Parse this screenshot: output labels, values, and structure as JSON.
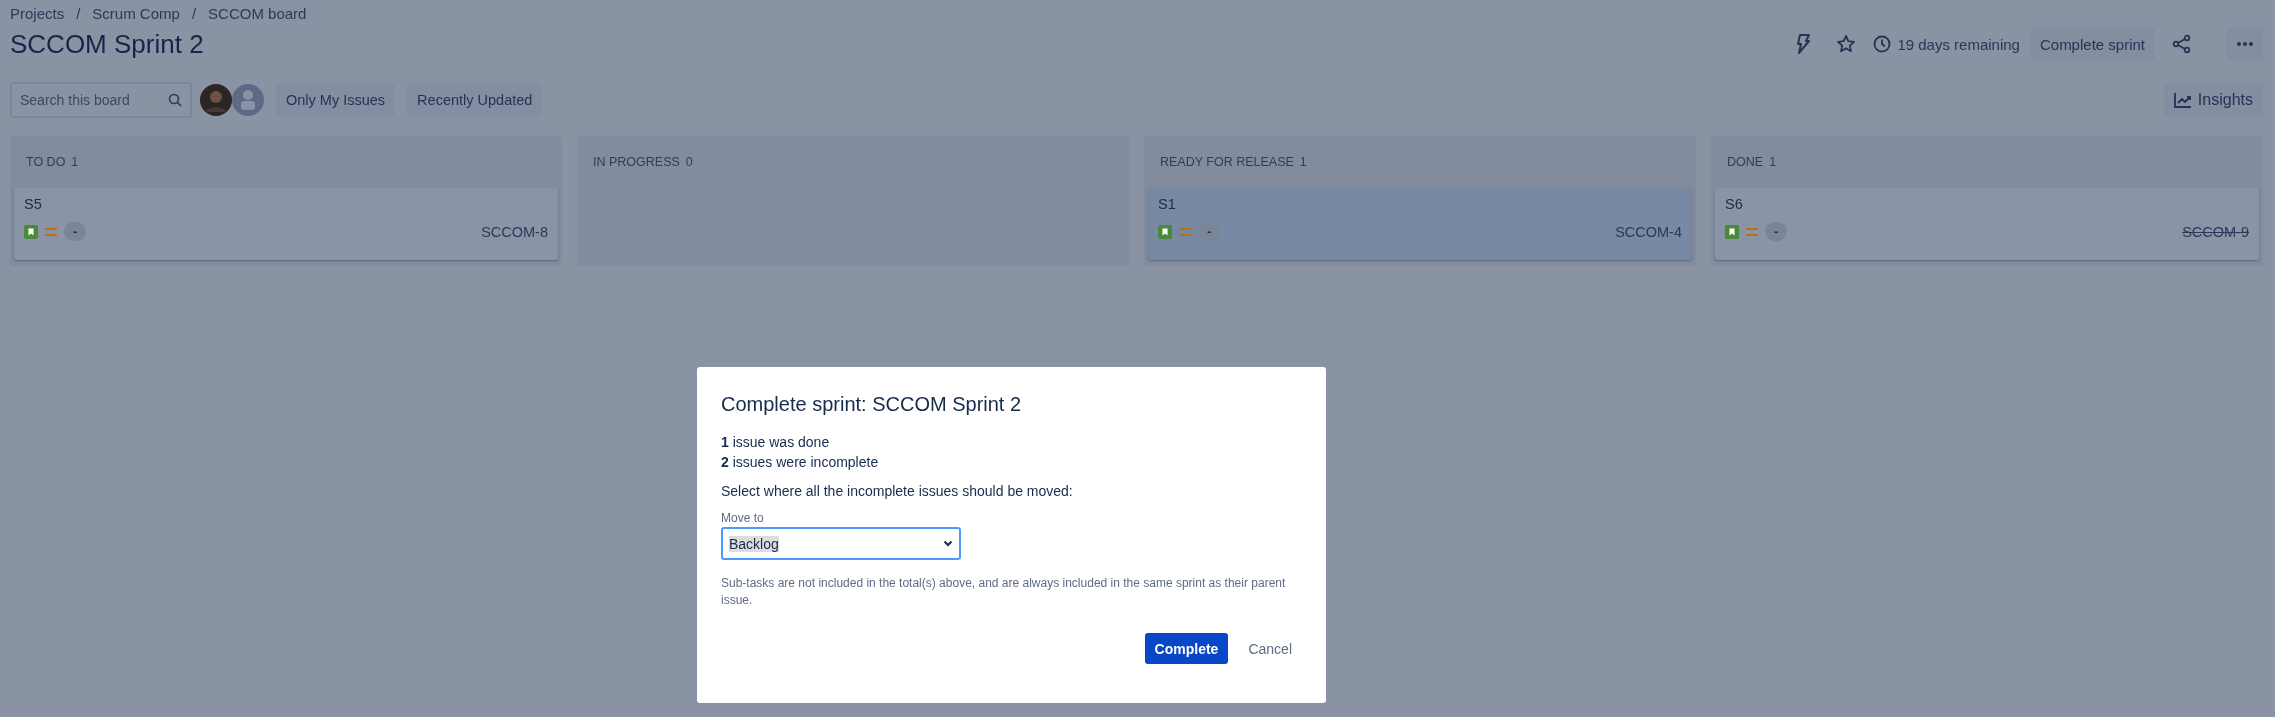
{
  "breadcrumbs": {
    "separator": "/",
    "items": [
      "Projects",
      "Scrum Comp",
      "SCCOM board"
    ]
  },
  "title": "SCCOM Sprint 2",
  "header_actions": {
    "remaining": "19 days remaining",
    "complete_button": "Complete sprint"
  },
  "toolbar": {
    "search": {
      "placeholder": "Search this board"
    },
    "avatars": [
      {
        "kind": "photo"
      },
      {
        "kind": "default"
      }
    ],
    "filters": [
      {
        "label": "Only My Issues",
        "selected": false
      },
      {
        "label": "Recently Updated",
        "selected": false
      }
    ],
    "insights_button": "Insights"
  },
  "columns": [
    {
      "title": "TO DO",
      "count": "1",
      "cards": [
        {
          "summary": "S5",
          "icons": [
            {
              "kind": "story"
            },
            {
              "kind": "medium_priority"
            }
          ],
          "badge": "-",
          "key": "SCCOM-8",
          "selected": false,
          "done": false
        }
      ]
    },
    {
      "title": "IN PROGRESS",
      "count": "0"
    },
    {
      "title": "READY FOR RELEASE",
      "count": "1",
      "cards": [
        {
          "summary": "S1",
          "icons": [
            {
              "kind": "story"
            },
            {
              "kind": "medium_priority"
            }
          ],
          "badge": "-",
          "key": "SCCOM-4",
          "selected": true,
          "done": false
        }
      ]
    },
    {
      "title": "DONE",
      "count": "1",
      "cards": [
        {
          "summary": "S6",
          "icons": [
            {
              "kind": "story"
            },
            {
              "kind": "medium_priority"
            }
          ],
          "badge": "-",
          "key": "SCCOM-9",
          "selected": false,
          "done": true
        }
      ]
    }
  ],
  "dialog": {
    "title": "Complete sprint: SCCOM Sprint 2",
    "stats": [
      "**1** issue was done",
      "**2** issues were incomplete"
    ],
    "prompt": "Select where all the incomplete issues should be moved:",
    "field": {
      "label": "Move to",
      "value": "Backlog"
    },
    "note": "Sub-tasks are not included in the total(s) above, and are always included in the same sprint as their parent issue.",
    "buttons": [
      {
        "label": "Complete",
        "kind": "primary"
      },
      {
        "label": "Cancel",
        "kind": "subtle"
      }
    ]
  }
}
